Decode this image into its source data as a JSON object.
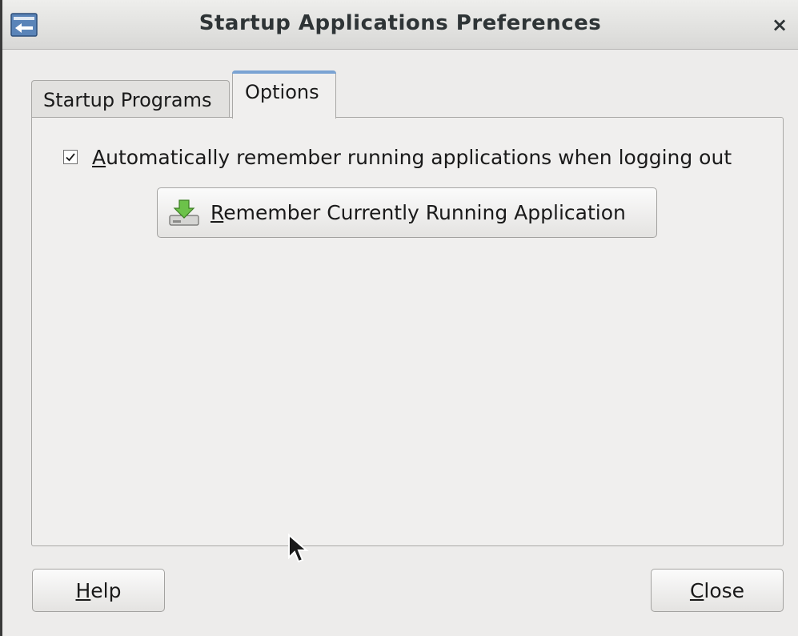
{
  "window": {
    "title": "Startup Applications Preferences",
    "close_glyph": "×"
  },
  "tabs": [
    {
      "label": "Startup Programs",
      "active": false
    },
    {
      "label": "Options",
      "active": true
    }
  ],
  "options": {
    "auto_remember": {
      "checked": true,
      "mnemonic": "A",
      "label_rest": "utomatically remember running applications when logging out"
    },
    "remember_button": {
      "icon": "save-download-icon",
      "mnemonic": "R",
      "label_rest": "emember Currently Running Application"
    }
  },
  "footer": {
    "help": {
      "mnemonic": "H",
      "label_rest": "elp"
    },
    "close": {
      "mnemonic": "C",
      "label_rest": "lose"
    }
  },
  "colors": {
    "active_tab_accent": "#7aa3d3",
    "window_bg": "#edeceb",
    "icon_green": "#4caf3a"
  }
}
